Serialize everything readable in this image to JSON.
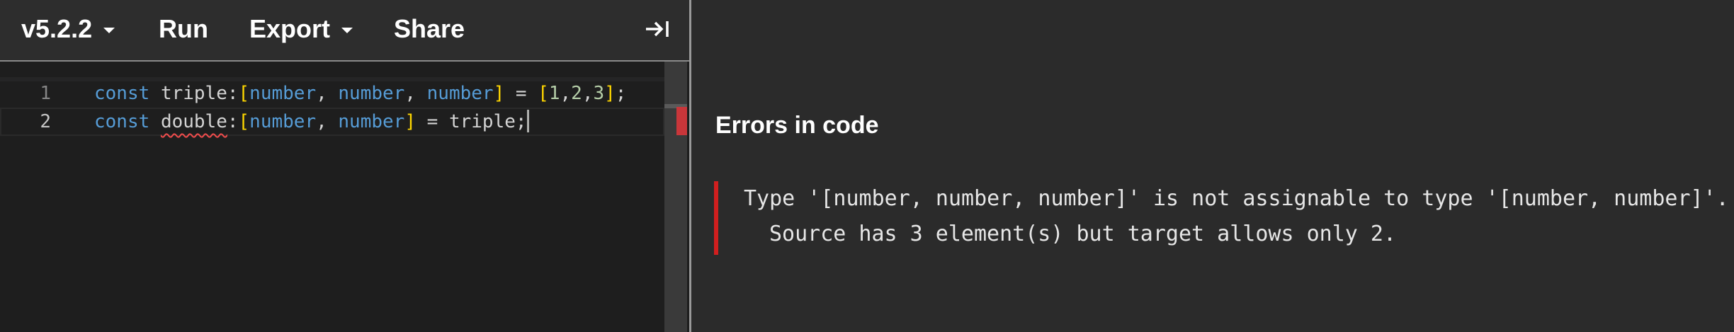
{
  "toolbar": {
    "version_label": "v5.2.2",
    "run_label": "Run",
    "export_label": "Export",
    "share_label": "Share",
    "collapse_icon": "collapse-right-icon"
  },
  "editor": {
    "lines": [
      {
        "number": "1",
        "tokens": {
          "kw": "const",
          "ident": "triple",
          "colon": ":",
          "lb": "[",
          "t1": "number",
          "c1": ",",
          "t2": "number",
          "c2": ",",
          "t3": "number",
          "rb": "]",
          "eq": "=",
          "alb": "[",
          "n1": "1",
          "ac1": ",",
          "n2": "2",
          "ac2": ",",
          "n3": "3",
          "arb": "]",
          "semi": ";"
        }
      },
      {
        "number": "2",
        "tokens": {
          "kw": "const",
          "ident": "double",
          "colon": ":",
          "lb": "[",
          "t1": "number",
          "c1": ",",
          "t2": "number",
          "rb": "]",
          "eq": "=",
          "value": "triple",
          "semi": ";"
        }
      }
    ]
  },
  "errors": {
    "title": "Errors in code",
    "message_line1": "Type '[number, number, number]' is not assignable to type '[number, number]'.",
    "message_line2": "Source has 3 element(s) but target allows only 2.",
    "accent_color": "#d11f1f"
  }
}
